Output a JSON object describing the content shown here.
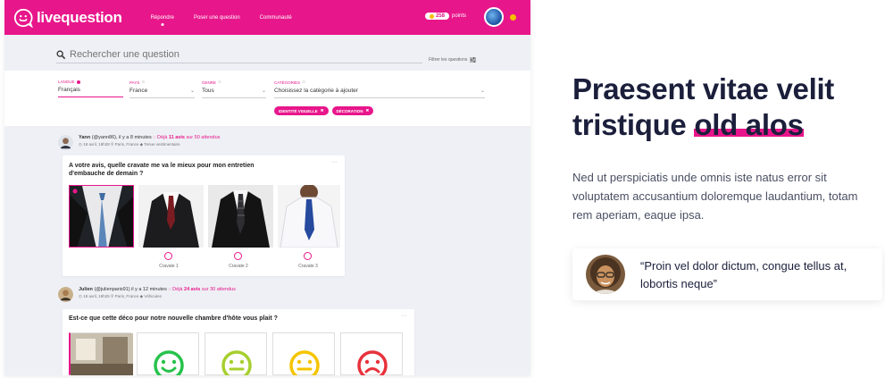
{
  "app": {
    "logo_text": "livequestion",
    "nav": [
      "Répondre",
      "Poser une question",
      "Communauté"
    ],
    "points_value": "258",
    "points_label": "points"
  },
  "search": {
    "placeholder": "Rechercher une question",
    "filter_link": "Filtrer les questions"
  },
  "filters": {
    "langue": {
      "label": "LANGUE",
      "value": "Français"
    },
    "pays": {
      "label": "PAYS",
      "value": "France"
    },
    "genre": {
      "label": "GENRE",
      "value": "Tous"
    },
    "categories": {
      "label": "CATÉGORIES",
      "value": "Choisissez la catégorie à ajouter"
    },
    "chips": [
      "IDENTITÉ VISUELLE",
      "DÉCORATION"
    ]
  },
  "question1": {
    "author": "Yann",
    "author_meta": "(@yann86), il y a 8 minutes",
    "avis_prefix": "Déjà",
    "avis_count": "11 avis",
    "avis_suffix": "sur 50 attendus",
    "date": "18 avril, 19h28",
    "location": "Paris, France",
    "category": "Tenue vestimentaire",
    "title": "A votre avis, quelle cravate me va le mieux pour mon entretien d'embauche de demain ?",
    "options": [
      "Cravate 1",
      "Cravate 2",
      "Cravate 3"
    ]
  },
  "question2": {
    "author": "Julien",
    "author_meta": "(@julienparis91) il y a 12 minutes",
    "avis_prefix": "Déjà",
    "avis_count": "24 avis",
    "avis_suffix": "sur 30 attendus",
    "date": "18 avril, 19h25",
    "location": "Paris, France",
    "category": "Véhicules",
    "title": "Est-ce que cette déco pour notre nouvelle chambre d'hôte vous plait ?"
  },
  "right": {
    "headline_line1": "Praesent vitae velit",
    "headline_line2_plain": "tristique ",
    "headline_line2_highlight": "old alos",
    "paragraph": "Ned ut perspiciatis unde omnis iste natus error sit voluptatem accusantium doloremque laudantium, totam rem aperiam, eaque ipsa.",
    "quote": "“Proin vel dolor dictum, congue tellus at, lobortis neque”"
  },
  "colors": {
    "brand": "#e8168b",
    "heading": "#1b1f3b",
    "body": "#4a4f63",
    "emoji_green": "#27c24c",
    "emoji_lime": "#a6cf2e",
    "emoji_yellow": "#f5c400",
    "emoji_red": "#e8323c"
  }
}
